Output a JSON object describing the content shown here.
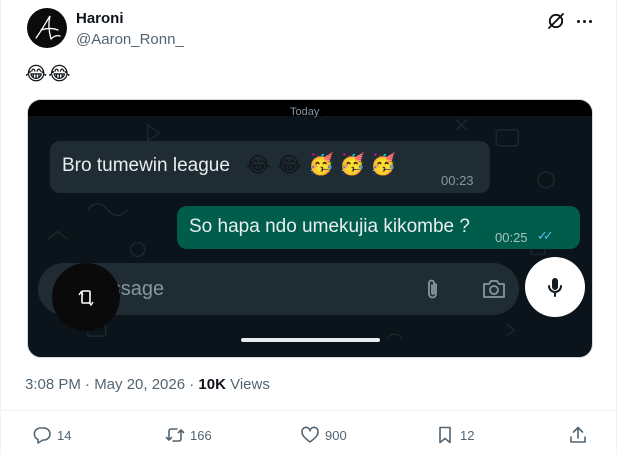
{
  "tweet": {
    "author_name": "Haroni",
    "author_handle": "@Aaron_Ronn_",
    "text": "😂😂",
    "timestamp": "3:08 PM · May 20, 2026 · ",
    "views_count": "10K",
    "views_label": " Views"
  },
  "media": {
    "top_label": "Today",
    "incoming": {
      "text": "Bro tumewin league",
      "emojis": [
        "😂",
        "😂",
        "🥳",
        "🥳",
        "🥳"
      ],
      "time": "00:23"
    },
    "outgoing": {
      "text": "So hapa ndo umekujia kikombe ?",
      "time": "00:25",
      "ticks": "✓✓"
    },
    "input_placeholder": "Message"
  },
  "actions": {
    "replies": "14",
    "reposts": "166",
    "likes": "900",
    "bookmarks": "12"
  },
  "colors": {
    "link_blue": "#1d9bf0",
    "wa_incoming": "#202c33",
    "wa_outgoing": "#005c4b",
    "wa_read_tick": "#53bdeb"
  },
  "icons": [
    "grok-icon",
    "more-icon",
    "attach-icon",
    "camera-icon",
    "mic-icon",
    "rotate-icon",
    "reply-icon",
    "repost-icon",
    "like-icon",
    "bookmark-icon",
    "share-icon"
  ]
}
